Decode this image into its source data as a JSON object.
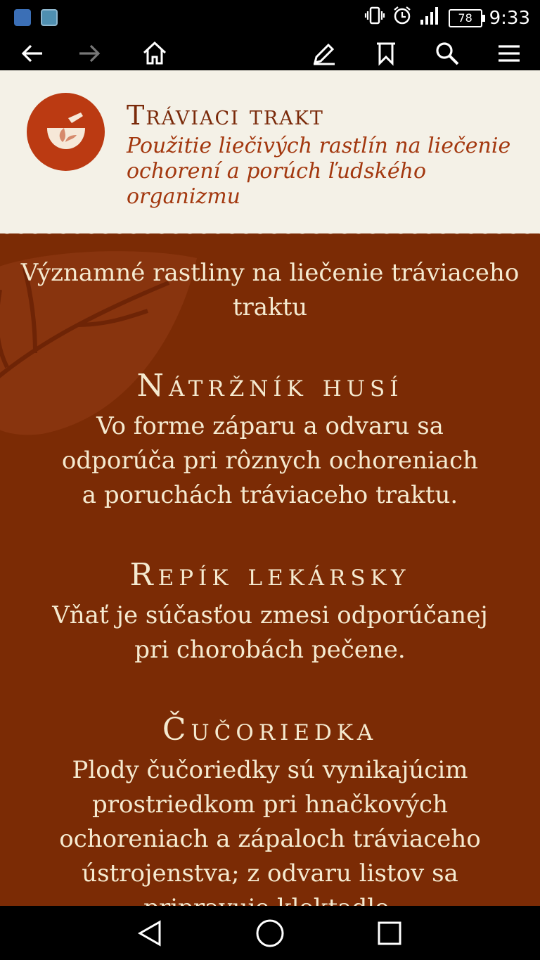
{
  "status_bar": {
    "battery": "78",
    "time": "9:33"
  },
  "toolbar": {
    "icons": [
      "back-arrow-icon",
      "forward-arrow-icon",
      "home-icon",
      "edit-pencil-icon",
      "bookmark-icon",
      "search-icon",
      "menu-icon"
    ]
  },
  "header": {
    "title": "Tráviaci trakt",
    "subtitle": "Použitie liečivých rastlín na liečenie ochorení a porúch ľudského organizmu"
  },
  "content": {
    "intro": "Významné rastliny na liečenie tráviaceho traktu",
    "plants": [
      {
        "name": "Nátržník husí",
        "description": "Vo forme záparu a odvaru sa odporúča pri rôznych ochoreniach a poruchách tráviaceho traktu."
      },
      {
        "name": "Repík lekársky",
        "description": "Vňať je súčasťou zmesi odporúčanej pri chorobách pečene."
      },
      {
        "name": "Čučoriedka",
        "description": "Plody čučoriedky sú vynikajúcim prostriedkom pri hnačkových ochoreniach a zápaloch tráviaceho ústrojenstva; z odvaru listov sa pripravuje kloktadlo."
      }
    ]
  },
  "colors": {
    "header_bg": "#f4f1e7",
    "content_bg": "#7b2b05",
    "accent": "#bb3a12",
    "text_light": "#f5ead0"
  }
}
